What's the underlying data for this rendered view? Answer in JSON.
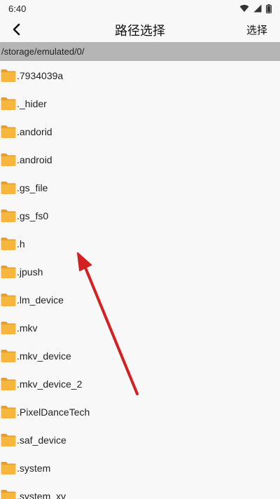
{
  "status_bar": {
    "time": "6:40",
    "icons": [
      "wifi-icon",
      "signal-icon",
      "battery-icon"
    ]
  },
  "app_bar": {
    "back_icon": "back-arrow-icon",
    "title": "路径选择",
    "select_label": "选择"
  },
  "path_bar": {
    "path": "/storage/emulated/0/"
  },
  "folders": [
    ".7934039a",
    "._hider",
    ".andorid",
    ".android",
    ".gs_file",
    ".gs_fs0",
    ".h",
    ".jpush",
    ".lm_device",
    ".mkv",
    ".mkv_device",
    ".mkv_device_2",
    ".PixelDanceTech",
    ".saf_device",
    ".system",
    ".system_xv"
  ],
  "colors": {
    "folder_body": "#f5b83d",
    "folder_tab": "#e89f27",
    "path_bar_bg": "#b5b5b5",
    "annotation_arrow": "#d32020"
  }
}
